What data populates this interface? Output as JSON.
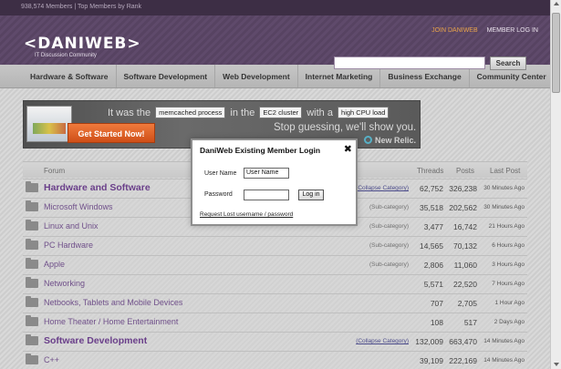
{
  "topstrip": {
    "text": "938,574 Members | Top Members by Rank"
  },
  "header": {
    "logo": "<DANIWEB>",
    "tagline": "IT Discussion Community",
    "join_label": "JOIN DANIWEB",
    "login_label": "MEMBER LOG IN",
    "search_placeholder": "",
    "search_label": "Search"
  },
  "nav": [
    "Hardware & Software",
    "Software Development",
    "Web Development",
    "Internet Marketing",
    "Business Exchange",
    "Community Center"
  ],
  "banner": {
    "it_was": "It was the",
    "sel1": "memcached process",
    "in_the": "in the",
    "sel2": "EC2 cluster",
    "with_a": "with a",
    "sel3": "high CPU load",
    "cta": "Get Started Now!",
    "slogan": "Stop guessing, we'll show you.",
    "brand": "New Relic."
  },
  "forum": {
    "headers": {
      "forum": "Forum",
      "threads": "Threads",
      "posts": "Posts",
      "last": "Last Post"
    },
    "rows": [
      {
        "name": "Hardware and Software",
        "cat": true,
        "tag": "(Collapse Category)",
        "threads": "62,752",
        "posts": "326,238",
        "last": "30 Minutes Ago"
      },
      {
        "name": "Microsoft Windows",
        "cat": false,
        "tag": "(Sub-category)",
        "threads": "35,518",
        "posts": "202,562",
        "last": "30 Minutes Ago"
      },
      {
        "name": "Linux and Unix",
        "cat": false,
        "tag": "(Sub-category)",
        "threads": "3,477",
        "posts": "16,742",
        "last": "21 Hours Ago"
      },
      {
        "name": "PC Hardware",
        "cat": false,
        "tag": "(Sub-category)",
        "threads": "14,565",
        "posts": "70,132",
        "last": "6 Hours Ago"
      },
      {
        "name": "Apple",
        "cat": false,
        "tag": "(Sub-category)",
        "threads": "2,806",
        "posts": "11,060",
        "last": "3 Hours Ago"
      },
      {
        "name": "Networking",
        "cat": false,
        "tag": "",
        "threads": "5,571",
        "posts": "22,520",
        "last": "7 Hours Ago"
      },
      {
        "name": "Netbooks, Tablets and Mobile Devices",
        "cat": false,
        "tag": "",
        "threads": "707",
        "posts": "2,705",
        "last": "1 Hour Ago"
      },
      {
        "name": "Home Theater / Home Entertainment",
        "cat": false,
        "tag": "",
        "threads": "108",
        "posts": "517",
        "last": "2 Days Ago"
      },
      {
        "name": "Software Development",
        "cat": true,
        "tag": "(Collapse Category)",
        "threads": "132,009",
        "posts": "663,470",
        "last": "14 Minutes Ago"
      },
      {
        "name": "C++",
        "cat": false,
        "tag": "",
        "threads": "39,109",
        "posts": "222,169",
        "last": "14 Minutes Ago"
      }
    ]
  },
  "modal": {
    "title": "DaniWeb Existing Member Login",
    "username_label": "User Name",
    "username_value": "User Name",
    "password_label": "Password",
    "login_button": "Log in",
    "lost_link": "Request Lost username / password"
  }
}
